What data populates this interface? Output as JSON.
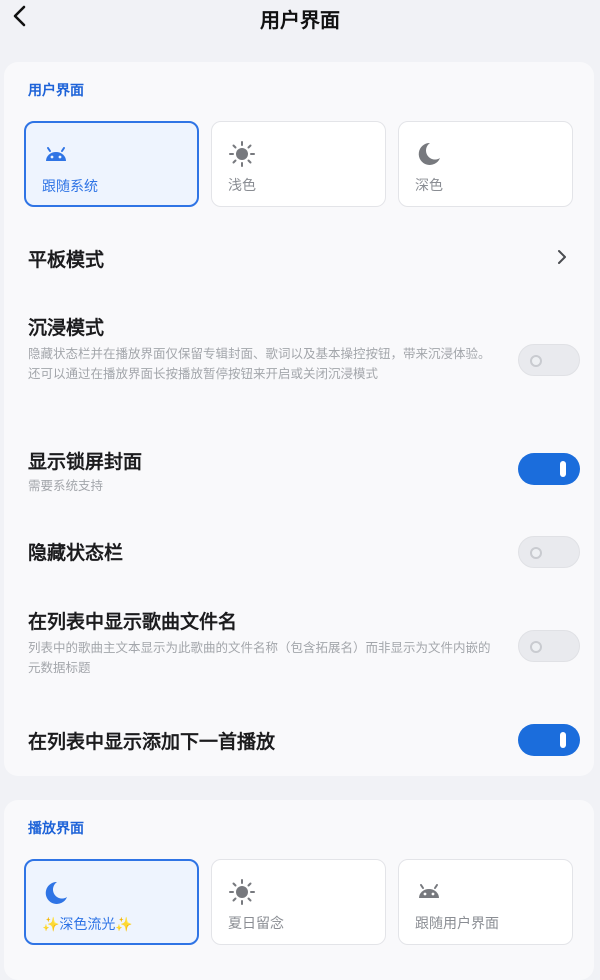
{
  "header": {
    "title": "用户界面",
    "back_icon": "back-arrow-icon"
  },
  "ui_section": {
    "title": "用户界面",
    "theme_options": [
      {
        "label": "跟随系统",
        "icon": "android-icon",
        "selected": true
      },
      {
        "label": "浅色",
        "icon": "sun-icon",
        "selected": false
      },
      {
        "label": "深色",
        "icon": "moon-icon",
        "selected": false
      }
    ]
  },
  "settings": {
    "tablet_mode": {
      "title": "平板模式"
    },
    "immersive_mode": {
      "title": "沉浸模式",
      "desc": "隐藏状态栏并在播放界面仅保留专辑封面、歌词以及基本操控按钮，带来沉浸体验。还可以通过在播放界面长按播放暂停按钮来开启或关闭沉浸模式",
      "enabled": false
    },
    "lockscreen_cover": {
      "title": "显示锁屏封面",
      "desc": "需要系统支持",
      "enabled": true
    },
    "hide_status_bar": {
      "title": "隐藏状态栏",
      "enabled": false
    },
    "show_filename": {
      "title": "在列表中显示歌曲文件名",
      "desc": "列表中的歌曲主文本显示为此歌曲的文件名称（包含拓展名）而非显示为文件内嵌的元数据标题",
      "enabled": false
    },
    "show_play_next": {
      "title": "在列表中显示添加下一首播放",
      "enabled": true
    }
  },
  "play_section": {
    "title": "播放界面",
    "options": [
      {
        "label": "✨深色流光✨",
        "icon": "moon-icon",
        "selected": true
      },
      {
        "label": "夏日留念",
        "icon": "sun-icon",
        "selected": false
      },
      {
        "label": "跟随用户界面",
        "icon": "android-icon",
        "selected": false
      }
    ]
  },
  "colors": {
    "accent": "#2f74e5",
    "switch_on": "#1b6ddc",
    "section_title": "#1e63d8"
  }
}
